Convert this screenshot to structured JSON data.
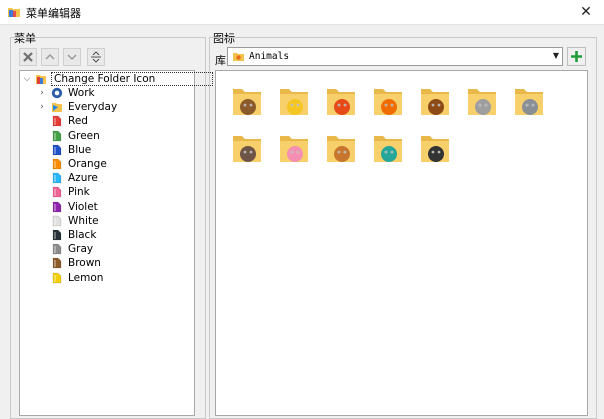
{
  "window": {
    "title": "菜单编辑器"
  },
  "menu_group": {
    "label": "菜单"
  },
  "icon_group": {
    "label": "图标"
  },
  "library": {
    "label": "库",
    "selected": "Animals"
  },
  "tree": {
    "root": "Change Folder Icon",
    "items": [
      {
        "label": "Work",
        "color": "#2d5fa8",
        "icon": "work-circle-icon",
        "expandable": true
      },
      {
        "label": "Everyday",
        "color": "#1e88e5",
        "icon": "everyday-folder-icon",
        "expandable": true
      },
      {
        "label": "Red",
        "color": "#e53935",
        "icon": "red-folder-icon"
      },
      {
        "label": "Green",
        "color": "#43a047",
        "icon": "green-folder-icon"
      },
      {
        "label": "Blue",
        "color": "#1e50c8",
        "icon": "blue-folder-icon"
      },
      {
        "label": "Orange",
        "color": "#fb8c00",
        "icon": "orange-folder-icon"
      },
      {
        "label": "Azure",
        "color": "#29b6f6",
        "icon": "azure-folder-icon"
      },
      {
        "label": "Pink",
        "color": "#f06292",
        "icon": "pink-folder-icon"
      },
      {
        "label": "Violet",
        "color": "#8e24aa",
        "icon": "violet-folder-icon"
      },
      {
        "label": "White",
        "color": "#e0e0e0",
        "icon": "white-folder-icon"
      },
      {
        "label": "Black",
        "color": "#263238",
        "icon": "black-folder-icon"
      },
      {
        "label": "Gray",
        "color": "#8c8c8c",
        "icon": "gray-folder-icon"
      },
      {
        "label": "Brown",
        "color": "#8d5a2b",
        "icon": "brown-folder-icon"
      },
      {
        "label": "Lemon",
        "color": "#f2d100",
        "icon": "lemon-folder-icon"
      }
    ]
  },
  "icons": [
    {
      "name": "dog-folder-icon",
      "color": "#8b5a2b"
    },
    {
      "name": "chick-folder-icon",
      "color": "#f3c623"
    },
    {
      "name": "crab-folder-icon",
      "color": "#e64a19"
    },
    {
      "name": "fox-folder-icon",
      "color": "#ef6c00"
    },
    {
      "name": "lion-folder-icon",
      "color": "#8d4a16"
    },
    {
      "name": "hippo-folder-icon",
      "color": "#9e9e9e"
    },
    {
      "name": "koala-folder-icon",
      "color": "#8a8f96"
    },
    {
      "name": "cow-folder-icon",
      "color": "#6d5447"
    },
    {
      "name": "pig-folder-icon",
      "color": "#f48fb1"
    },
    {
      "name": "squirrel-folder-icon",
      "color": "#c6762e"
    },
    {
      "name": "bird-folder-icon",
      "color": "#26a69a"
    },
    {
      "name": "zebra-folder-icon",
      "color": "#333333"
    }
  ]
}
